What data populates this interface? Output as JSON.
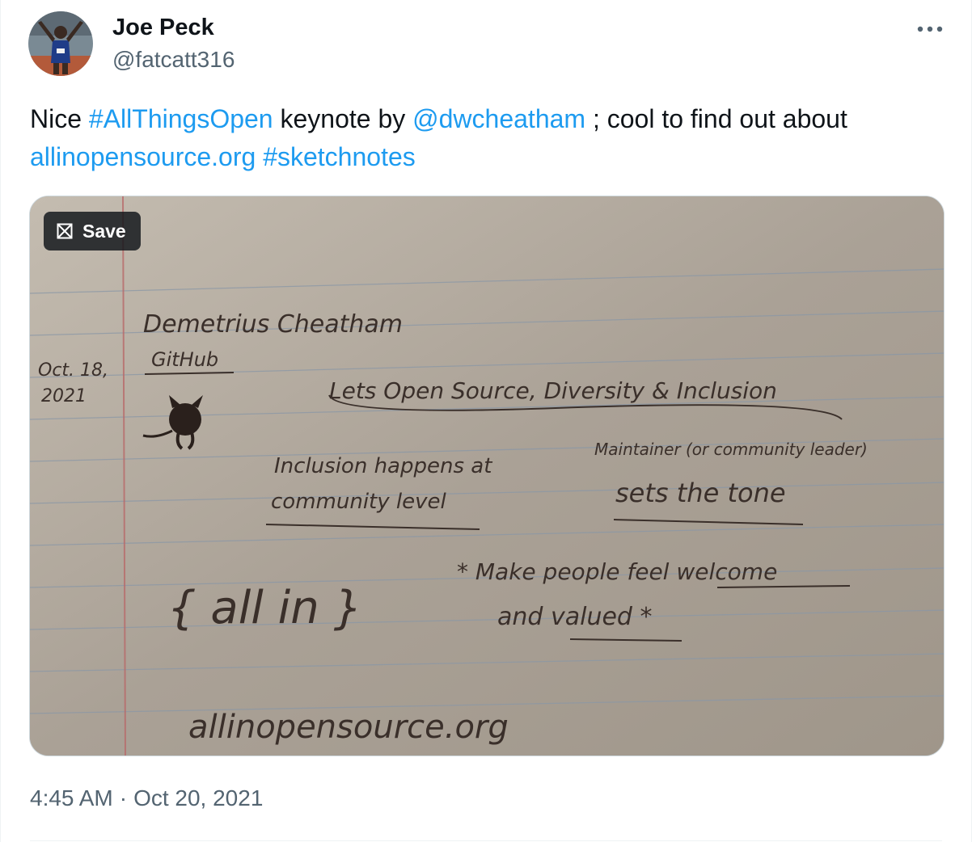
{
  "author": {
    "name": "Joe Peck",
    "handle": "@fatcatt316"
  },
  "tweet": {
    "parts": {
      "t1": "Nice ",
      "hashtag1": "#AllThingsOpen",
      "t2": " keynote by ",
      "mention": "@dwcheatham",
      "t3": " ; cool to find out about",
      "link": "allinopensource.org",
      "t4": " ",
      "hashtag2": "#sketchnotes"
    }
  },
  "media": {
    "save_label": "Save",
    "sketch": {
      "speaker": "Demetrius Cheatham",
      "company": "GitHub",
      "date_line1": "Oct. 18,",
      "date_line2": "2021",
      "topic": "Lets Open Source, Diversity & Inclusion",
      "note1_line1": "Inclusion happens at",
      "note1_line2": "community level",
      "note2_line1": "Maintainer (or community leader)",
      "note2_line2": "sets the tone",
      "brace_text": "{ all in }",
      "note3_line1": "* Make people feel welcome",
      "note3_line2": "and valued *",
      "url": "allinopensource.org"
    }
  },
  "meta": {
    "time": "4:45 AM",
    "separator": "·",
    "date": "Oct 20, 2021"
  },
  "colors": {
    "link": "#1d9bf0",
    "secondary_text": "#536471",
    "primary_text": "#0f1419"
  },
  "icons": {
    "more": "more-horizontal-icon",
    "save": "bookmark-save-icon"
  }
}
